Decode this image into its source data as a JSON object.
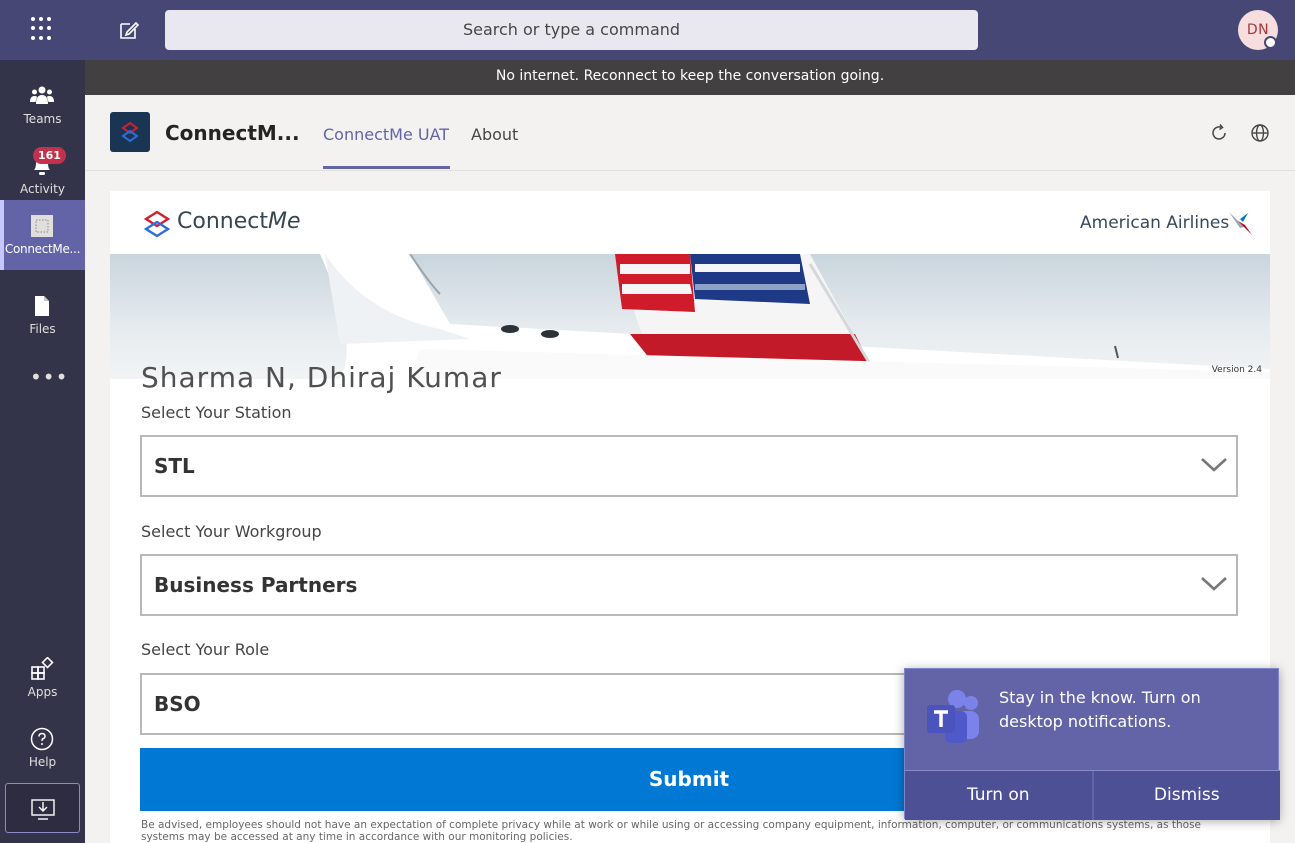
{
  "topbar": {
    "search_placeholder": "Search or type a command",
    "avatar_initials": "DN"
  },
  "rail": {
    "items": [
      {
        "label": "Teams",
        "icon": "teams-icon"
      },
      {
        "label": "Activity",
        "icon": "bell-icon",
        "badge": "161"
      },
      {
        "label": "ConnectMe...",
        "icon": "app-icon"
      },
      {
        "label": "Files",
        "icon": "file-icon"
      }
    ],
    "more": "•••",
    "bottom": [
      {
        "label": "Apps",
        "icon": "apps-icon"
      },
      {
        "label": "Help",
        "icon": "help-icon"
      }
    ]
  },
  "offline_banner": "No internet. Reconnect to keep the conversation going.",
  "app": {
    "name": "ConnectM...",
    "tabs": [
      "ConnectMe UAT",
      "About"
    ]
  },
  "content": {
    "brand_connect": "Connect",
    "brand_me": "Me",
    "partner_logo": "American Airlines",
    "version": "Version 2.4",
    "user_name": "Sharma N, Dhiraj Kumar",
    "station_label": "Select Your Station",
    "station_value": "STL",
    "workgroup_label": "Select Your Workgroup",
    "workgroup_value": "Business Partners",
    "role_label": "Select Your Role",
    "role_value": "BSO",
    "submit_label": "Submit",
    "disclaimer": "Be advised, employees should not have an expectation of complete privacy while at work or while using or accessing company equipment, information, computer, or communications systems, as those systems may be accessed at any time in accordance with our monitoring policies."
  },
  "toast": {
    "message": "Stay in the know. Turn on desktop notifications.",
    "turn_on": "Turn on",
    "dismiss": "Dismiss"
  },
  "colors": {
    "brand_purple": "#6264a7",
    "topbar": "#464775",
    "rail": "#33344a",
    "submit_blue": "#0078d4"
  }
}
